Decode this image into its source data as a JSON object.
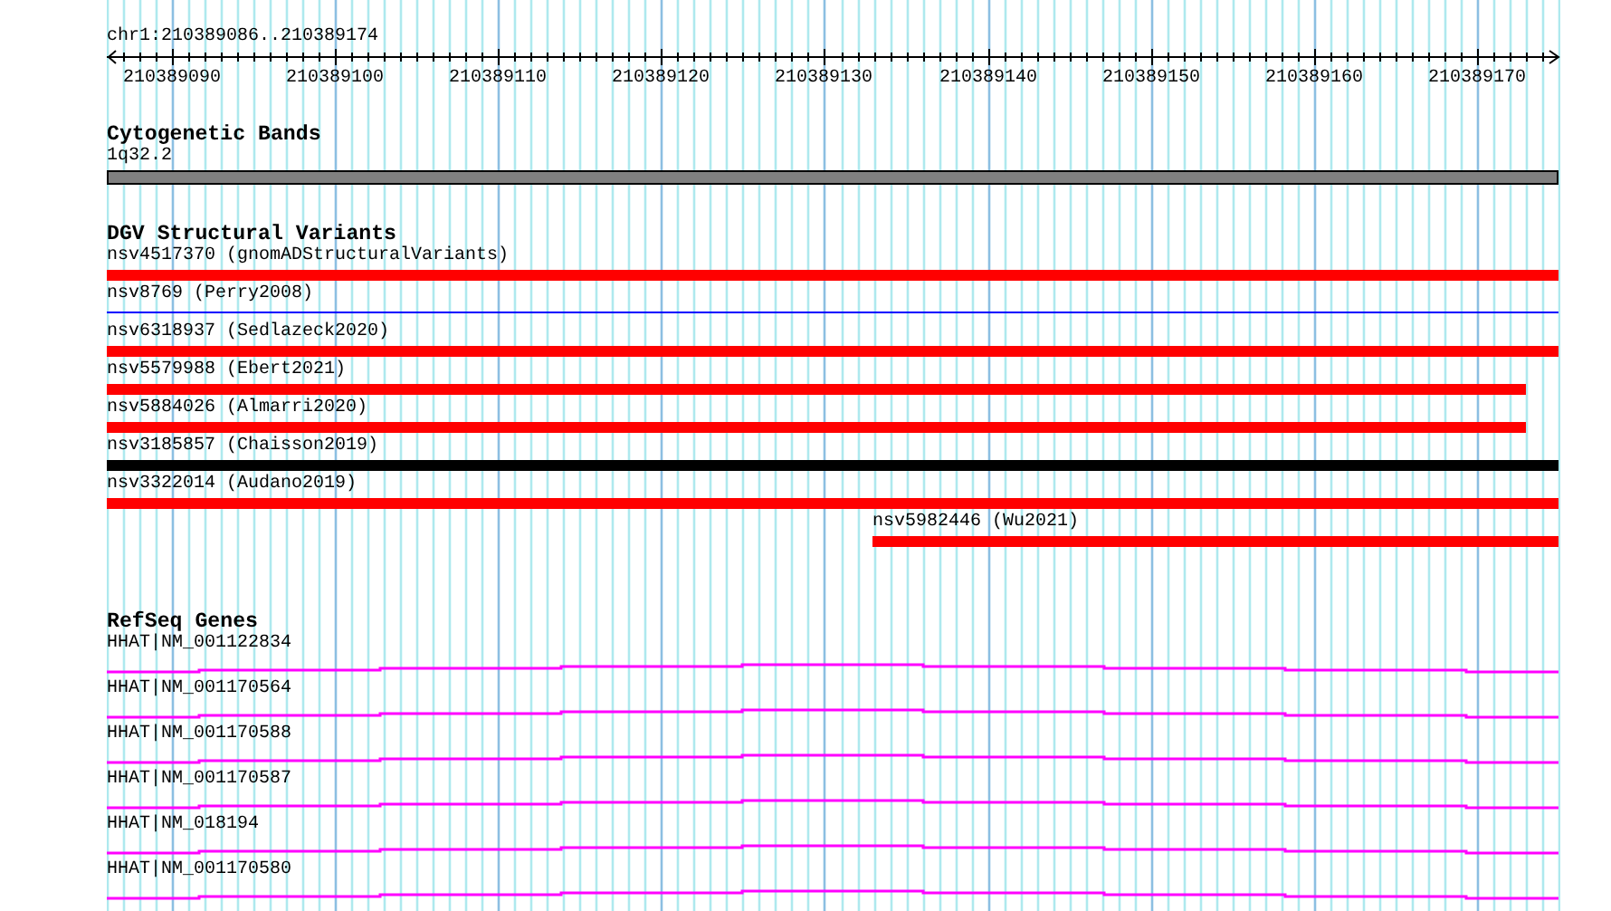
{
  "ruler": {
    "location": "chr1:210389086..210389174",
    "ticks": [
      "210389090",
      "210389100",
      "210389110",
      "210389120",
      "210389130",
      "210389140",
      "210389150",
      "210389160",
      "210389170"
    ]
  },
  "tracks": [
    {
      "kind": "bands",
      "title": "Cytogenetic Bands",
      "features": [
        {
          "label": "1q32.2",
          "kind": "bar",
          "color": "#808080"
        }
      ]
    },
    {
      "kind": "variants",
      "title": "DGV Structural Variants",
      "features": [
        {
          "label": "nsv4517370 (gnomADStructuralVariants)",
          "kind": "bar",
          "color": "#ff0000"
        },
        {
          "label": "nsv8769 (Perry2008)",
          "kind": "line",
          "color": "#0000ff"
        },
        {
          "label": "nsv6318937 (Sedlazeck2020)",
          "kind": "bar",
          "color": "#ff0000"
        },
        {
          "label": "nsv5579988 (Ebert2021)",
          "kind": "shortbar",
          "color": "#ff0000"
        },
        {
          "label": "nsv5884026 (Almarri2020)",
          "kind": "shortbar",
          "color": "#ff0000"
        },
        {
          "label": "nsv3185857 (Chaisson2019)",
          "kind": "bar",
          "color": "#000000"
        },
        {
          "label": "nsv3322014 (Audano2019)",
          "kind": "bar",
          "color": "#ff0000"
        },
        {
          "label": "nsv5982446 (Wu2021)",
          "kind": "latebar",
          "color": "#ff0000"
        }
      ]
    },
    {
      "kind": "genes",
      "title": "RefSeq Genes",
      "features": [
        {
          "label": "HHAT|NM_001122834"
        },
        {
          "label": "HHAT|NM_001170564"
        },
        {
          "label": "HHAT|NM_001170588"
        },
        {
          "label": "HHAT|NM_001170587"
        },
        {
          "label": "HHAT|NM_018194"
        },
        {
          "label": "HHAT|NM_001170580"
        }
      ]
    }
  ]
}
